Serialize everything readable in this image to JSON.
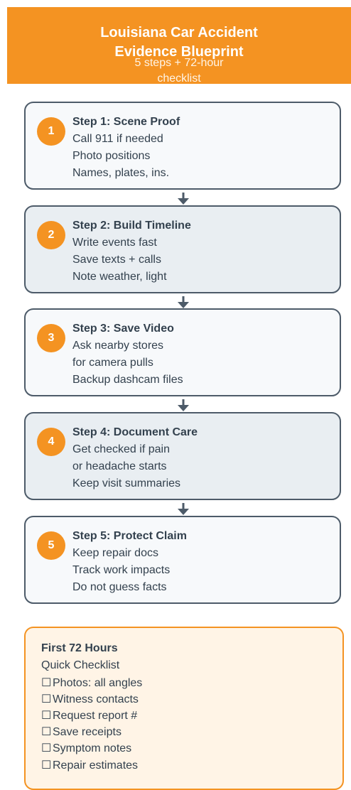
{
  "header": {
    "title_line1": "Louisiana Car Accident",
    "title_line2": "Evidence Blueprint",
    "subtitle_line1": "5 steps + 72-hour",
    "subtitle_line2": "checklist"
  },
  "steps": [
    {
      "number": "1",
      "title": "Step 1: Scene Proof",
      "lines": [
        "Call 911 if needed",
        "Photo positions",
        "Names, plates, ins."
      ]
    },
    {
      "number": "2",
      "title": "Step 2: Build Timeline",
      "lines": [
        "Write events fast",
        "Save texts + calls",
        "Note weather, light"
      ]
    },
    {
      "number": "3",
      "title": "Step 3: Save Video",
      "lines": [
        "Ask nearby stores",
        "for camera pulls",
        "Backup dashcam files"
      ]
    },
    {
      "number": "4",
      "title": "Step 4: Document Care",
      "lines": [
        "Get checked if pain",
        "or headache starts",
        "Keep visit summaries"
      ]
    },
    {
      "number": "5",
      "title": "Step 5: Protect Claim",
      "lines": [
        "Keep repair docs",
        "Track work impacts",
        "Do not guess facts"
      ]
    }
  ],
  "checklist": {
    "title": "First 72 Hours",
    "subtitle": "Quick Checklist",
    "checkbox_glyph": "☐",
    "items": [
      "Photos: all angles",
      "Witness contacts",
      "Request report #",
      "Save receipts",
      "Symptom notes",
      "Repair estimates"
    ]
  },
  "colors": {
    "accent": "#f49322",
    "border": "#4d5b69",
    "text": "#33414e"
  }
}
